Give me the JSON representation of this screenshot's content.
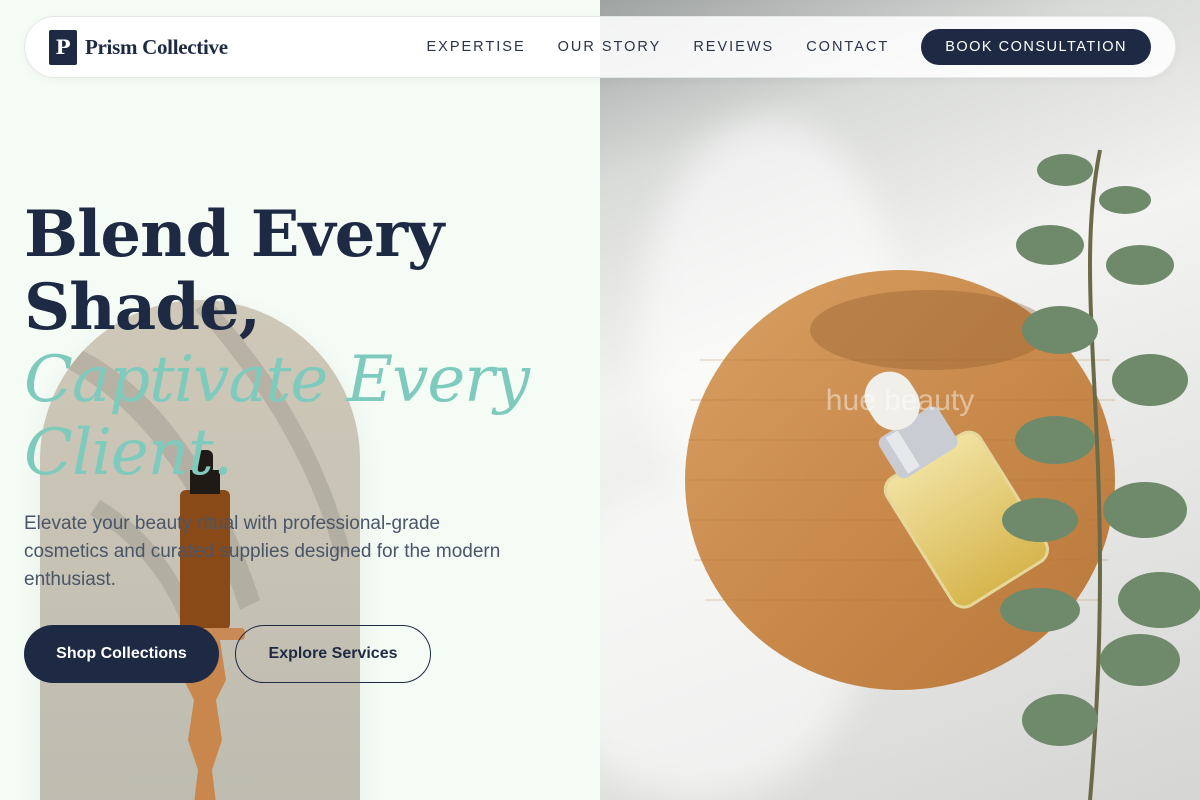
{
  "brand": {
    "logo_letter": "P",
    "name": "Prism Collective"
  },
  "nav": {
    "links": [
      "EXPERTISE",
      "OUR STORY",
      "REVIEWS",
      "CONTACT"
    ],
    "cta": "BOOK CONSULTATION"
  },
  "hero": {
    "title_line1": "Blend Every",
    "title_line2": "Shade,",
    "title_accent1": "Captivate Every",
    "title_accent2": "Client.",
    "subtitle": "Elevate your beauty ritual with professional-grade cosmetics and curated supplies designed for the modern enthusiast.",
    "primary_button": "Shop Collections",
    "secondary_button": "Explore Services"
  },
  "photo_right": {
    "watermark": "hue beauty"
  },
  "colors": {
    "navy": "#1e2a44",
    "accent": "#7ecbbd",
    "background": "#f5fcf6"
  }
}
